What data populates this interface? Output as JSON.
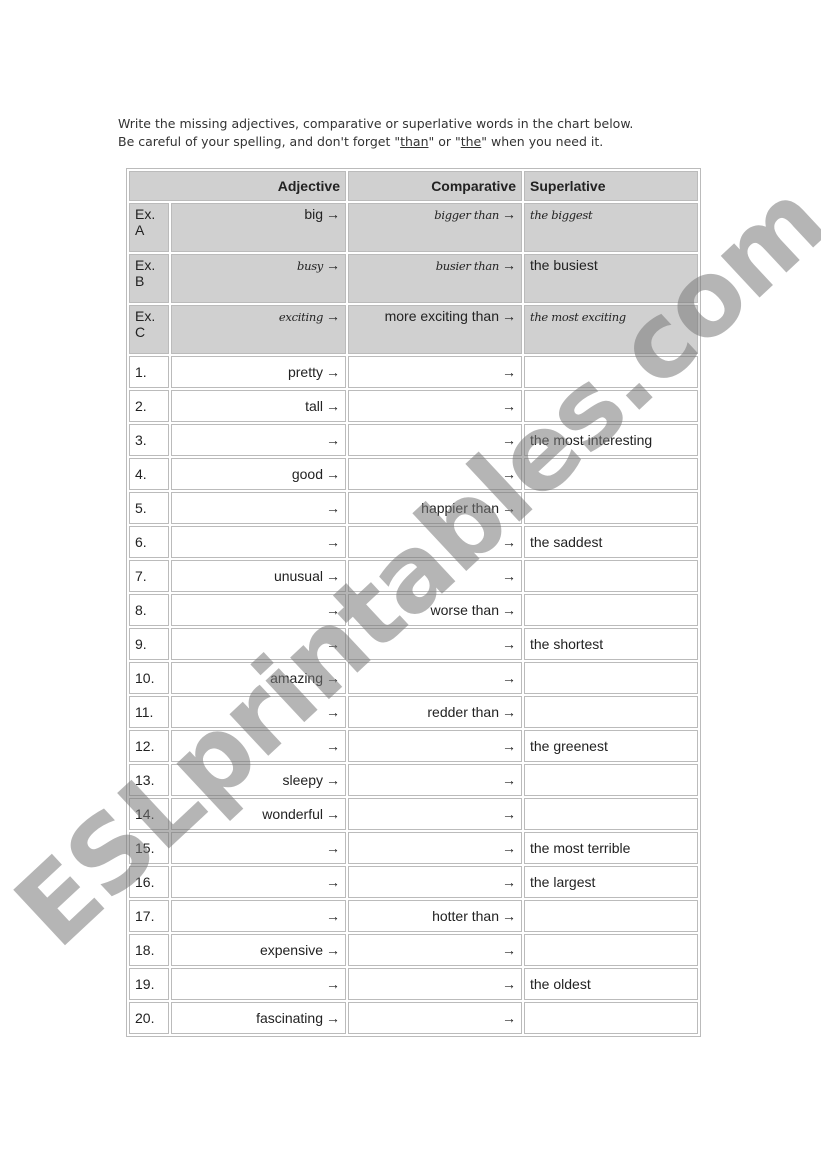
{
  "instructions": {
    "line1": "Write the missing adjectives, comparative or superlative words in the chart below.",
    "line2_a": "Be careful of your spelling, and don't forget \"",
    "than": "than",
    "line2_b": "\" or \"",
    "the": "the",
    "line2_c": "\" when you need it."
  },
  "table": {
    "headers": {
      "adjective": "Adjective",
      "comparative": "Comparative",
      "superlative": "Superlative"
    },
    "arrow": "→",
    "examples": [
      {
        "label": "Ex. A",
        "adjective": "big",
        "comparative": "bigger than",
        "superlative": "the biggest"
      },
      {
        "label": "Ex. B",
        "adjective": "busy",
        "comparative": "busier than",
        "superlative": "the busiest"
      },
      {
        "label": "Ex. C",
        "adjective": "exciting",
        "comparative": "more exciting than",
        "superlative": "the most exciting"
      }
    ],
    "rows": [
      {
        "num": "1.",
        "adjective": "pretty",
        "comparative": "",
        "superlative": ""
      },
      {
        "num": "2.",
        "adjective": "tall",
        "comparative": "",
        "superlative": ""
      },
      {
        "num": "3.",
        "adjective": "",
        "comparative": "",
        "superlative": "the most interesting"
      },
      {
        "num": "4.",
        "adjective": "good",
        "comparative": "",
        "superlative": ""
      },
      {
        "num": "5.",
        "adjective": "",
        "comparative": "happier than",
        "superlative": ""
      },
      {
        "num": "6.",
        "adjective": "",
        "comparative": "",
        "superlative": "the saddest"
      },
      {
        "num": "7.",
        "adjective": "unusual",
        "comparative": "",
        "superlative": ""
      },
      {
        "num": "8.",
        "adjective": "",
        "comparative": "worse than",
        "superlative": ""
      },
      {
        "num": "9.",
        "adjective": "",
        "comparative": "",
        "superlative": "the shortest"
      },
      {
        "num": "10.",
        "adjective": "amazing",
        "comparative": "",
        "superlative": ""
      },
      {
        "num": "11.",
        "adjective": "",
        "comparative": "redder than",
        "superlative": ""
      },
      {
        "num": "12.",
        "adjective": "",
        "comparative": "",
        "superlative": "the greenest"
      },
      {
        "num": "13.",
        "adjective": "sleepy",
        "comparative": "",
        "superlative": ""
      },
      {
        "num": "14.",
        "adjective": "wonderful",
        "comparative": "",
        "superlative": ""
      },
      {
        "num": "15.",
        "adjective": "",
        "comparative": "",
        "superlative": " the most terrible"
      },
      {
        "num": "16.",
        "adjective": "",
        "comparative": "",
        "superlative": "the largest"
      },
      {
        "num": "17.",
        "adjective": "",
        "comparative": "hotter than",
        "superlative": ""
      },
      {
        "num": "18.",
        "adjective": "expensive",
        "comparative": "",
        "superlative": ""
      },
      {
        "num": "19.",
        "adjective": "",
        "comparative": "",
        "superlative": "the oldest"
      },
      {
        "num": "20.",
        "adjective": "fascinating",
        "comparative": "",
        "superlative": ""
      }
    ]
  },
  "watermark": "ESLprintables.com"
}
